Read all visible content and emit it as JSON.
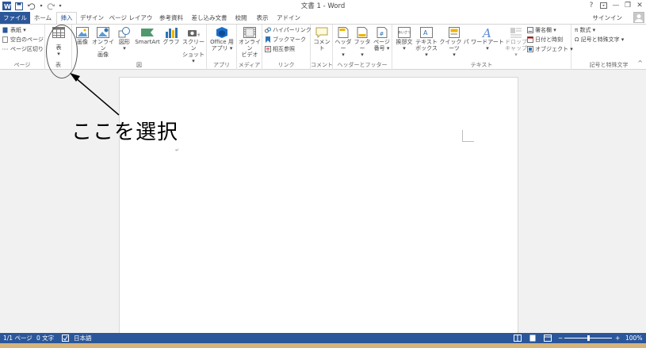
{
  "titlebar": {
    "title": "文書 1 - Word",
    "help": "?",
    "ribbon_options_icon": "ribbon-display-options-icon",
    "minimize": "—",
    "restore": "❐",
    "close": "✕"
  },
  "tabs": [
    {
      "label": "ファイル"
    },
    {
      "label": "ホーム"
    },
    {
      "label": "挿入"
    },
    {
      "label": "デザイン"
    },
    {
      "label": "ページ レイアウト"
    },
    {
      "label": "参考資料"
    },
    {
      "label": "差し込み文書"
    },
    {
      "label": "校閲"
    },
    {
      "label": "表示"
    },
    {
      "label": "アドイン"
    }
  ],
  "signin": "サインイン",
  "ribbon": {
    "pages": {
      "label": "ページ",
      "cover": "表紙 ▾",
      "blank": "空白のページ",
      "break": "ページ区切り"
    },
    "table": {
      "label": "表",
      "button": "表",
      "arrow": "▾"
    },
    "illustrations": {
      "label": "図",
      "picture": "画像",
      "online_line1": "オンライン",
      "online_line2": "画像",
      "shapes": "図形",
      "shapes_arrow": "▾",
      "smartart": "SmartArt",
      "chart": "グラフ",
      "screenshot_line1": "スクリーン",
      "screenshot_line2": "ショット ▾"
    },
    "apps": {
      "label": "アプリ",
      "line1": "Office 用",
      "line2": "アプリ ▾"
    },
    "media": {
      "label": "メディア",
      "line1": "オンライン",
      "line2": "ビデオ"
    },
    "links": {
      "label": "リンク",
      "hyperlink": "ハイパーリンク",
      "bookmark": "ブックマーク",
      "crossref": "相互参照"
    },
    "comments": {
      "label": "コメント",
      "button": "コメント"
    },
    "headerfooter": {
      "label": "ヘッダーとフッター",
      "header": "ヘッダー",
      "header_arrow": "▾",
      "footer": "フッター",
      "footer_arrow": "▾",
      "pagenum_line1": "ページ",
      "pagenum_line2": "番号 ▾"
    },
    "text": {
      "label": "テキスト",
      "greeting": "挨拶文",
      "greeting_arrow": "▾",
      "textbox_line1": "テキスト",
      "textbox_line2": "ボックス ▾",
      "quickparts": "クイック パーツ",
      "quickparts_arrow": "▾",
      "wordart": "ワードアート",
      "wordart_arrow": "▾",
      "dropcap_line1": "ドロップ",
      "dropcap_line2": "キャップ ▾",
      "signature": "署名欄 ▾",
      "datetime": "日付と時刻",
      "object": "オブジェクト ▾",
      "greeting_icon_text": "あいさつ"
    },
    "symbols": {
      "label": "記号と特殊文字",
      "equation": "π 数式 ▾",
      "symbol": "Ω 記号と特殊文字 ▾"
    },
    "collapse": "^"
  },
  "annotation": {
    "text": "ここを選択"
  },
  "statusbar": {
    "page": "1/1 ページ",
    "words": "0 文字",
    "language": "日本語",
    "zoom_minus": "−",
    "zoom_plus": "+",
    "zoom": "100%",
    "zoom_level_pct": 50
  },
  "colors": {
    "accent": "#2b579a",
    "chart_blue": "#2e75b6",
    "status_bar": "#2b579a"
  }
}
